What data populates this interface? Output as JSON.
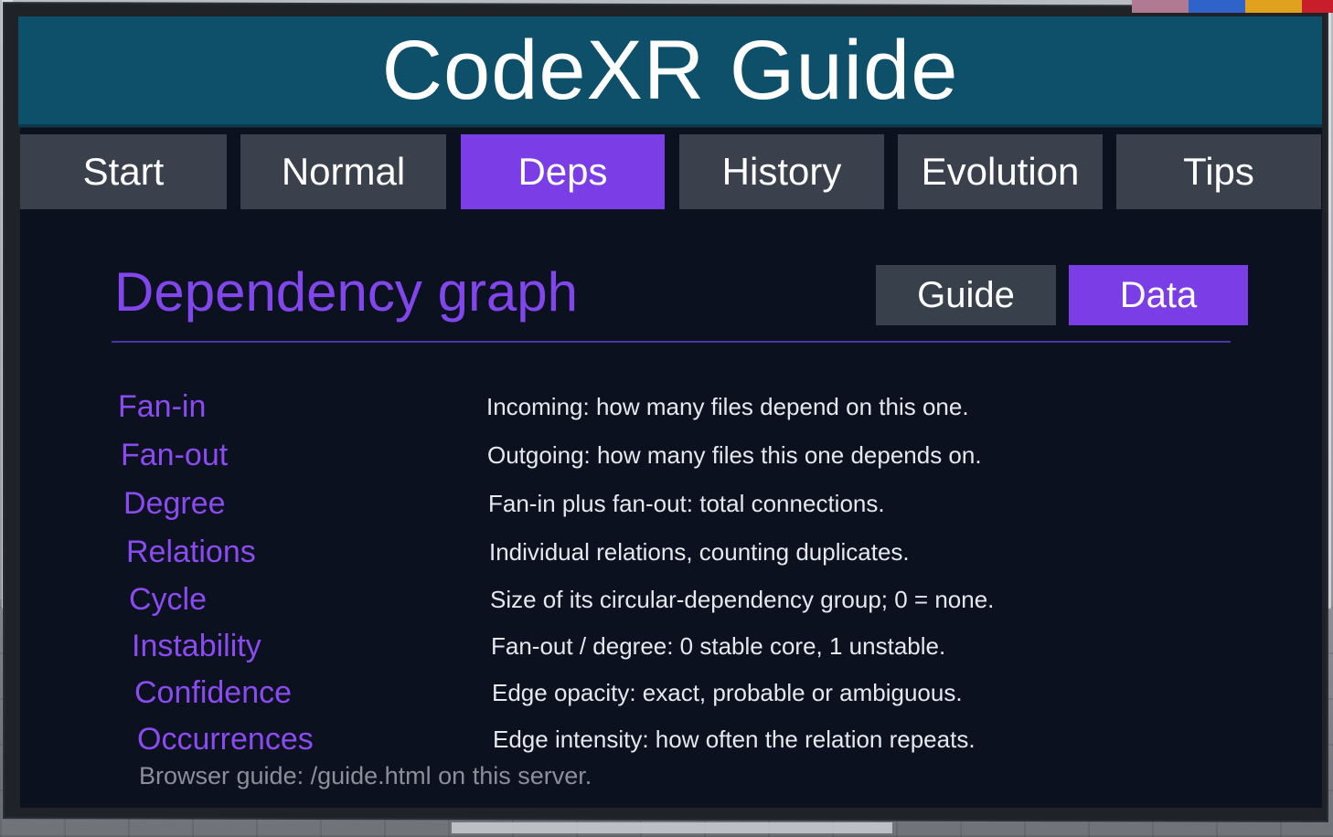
{
  "app": {
    "title": "CodeXR Guide"
  },
  "colors": {
    "accent": "#7b3ee6",
    "header": "#0e4f6a",
    "panel": "#0c1120",
    "tab": "#3a414d"
  },
  "swatches": [
    "#b07a92",
    "#2f63c9",
    "#e0a11f",
    "#c81e2b"
  ],
  "tabs": [
    {
      "label": "Start",
      "active": false
    },
    {
      "label": "Normal",
      "active": false
    },
    {
      "label": "Deps",
      "active": true
    },
    {
      "label": "History",
      "active": false
    },
    {
      "label": "Evolution",
      "active": false
    },
    {
      "label": "Tips",
      "active": false
    }
  ],
  "section": {
    "title": "Dependency graph",
    "modes": [
      {
        "label": "Guide",
        "active": false
      },
      {
        "label": "Data",
        "active": true
      }
    ]
  },
  "metrics": [
    {
      "term": "Fan-in",
      "desc": "Incoming: how many files depend on this one."
    },
    {
      "term": "Fan-out",
      "desc": "Outgoing: how many files this one depends on."
    },
    {
      "term": "Degree",
      "desc": "Fan-in plus fan-out: total connections."
    },
    {
      "term": "Relations",
      "desc": "Individual relations, counting duplicates."
    },
    {
      "term": "Cycle",
      "desc": "Size of its circular-dependency group; 0 = none."
    },
    {
      "term": "Instability",
      "desc": "Fan-out / degree: 0 stable core, 1 unstable."
    },
    {
      "term": "Confidence",
      "desc": "Edge opacity: exact, probable or ambiguous."
    },
    {
      "term": "Occurrences",
      "desc": "Edge intensity: how often the relation repeats."
    }
  ],
  "footer": {
    "text": "Browser guide: /guide.html on this server."
  }
}
